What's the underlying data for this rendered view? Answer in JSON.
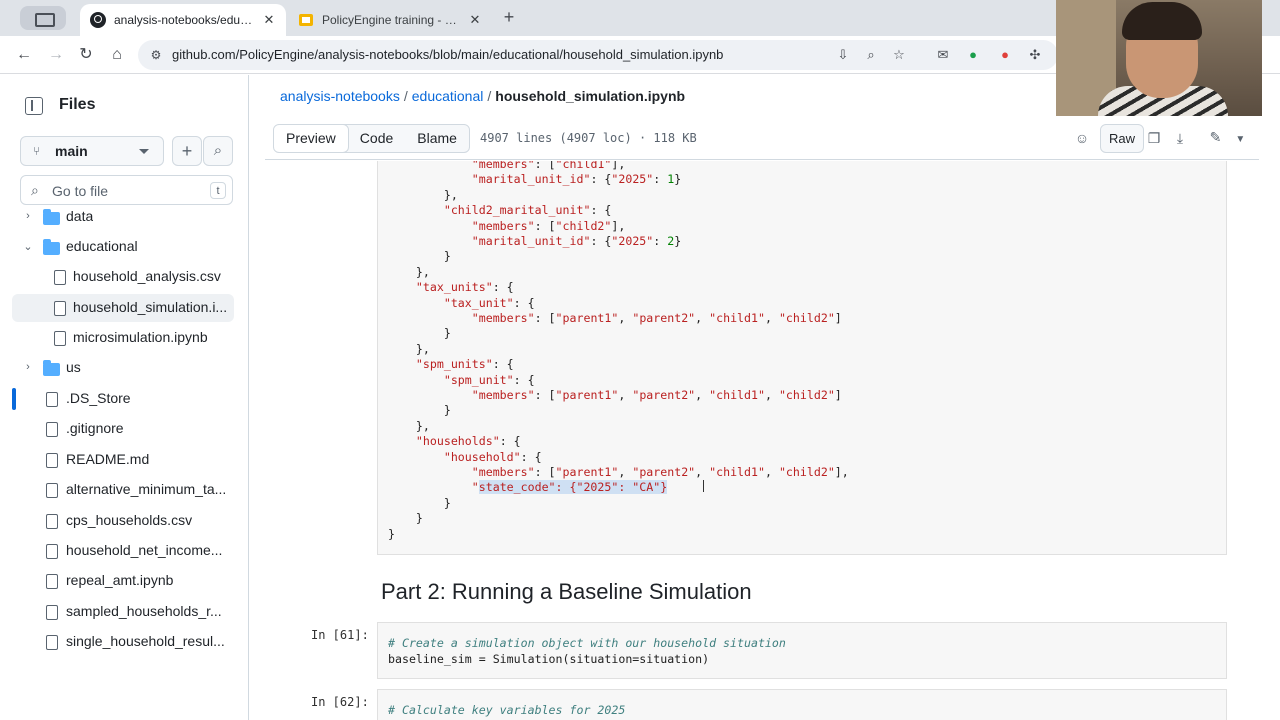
{
  "browser": {
    "tabs": [
      {
        "title": "analysis-notebooks/educatio",
        "active": true
      },
      {
        "title": "PolicyEngine training - 25th J",
        "active": false
      }
    ],
    "url": "github.com/PolicyEngine/analysis-notebooks/blob/main/educational/household_simulation.ipynb"
  },
  "sidebar": {
    "title": "Files",
    "branch": "main",
    "goto_placeholder": "Go to file",
    "goto_shortcut": "t",
    "tree": [
      {
        "label": "data",
        "kind": "folder",
        "expanded": false
      },
      {
        "label": "educational",
        "kind": "folder",
        "expanded": true
      },
      {
        "label": "household_analysis.csv",
        "kind": "file"
      },
      {
        "label": "household_simulation.i...",
        "kind": "file",
        "selected": true
      },
      {
        "label": "microsimulation.ipynb",
        "kind": "file"
      },
      {
        "label": "us",
        "kind": "folder",
        "expanded": false
      },
      {
        "label": ".DS_Store",
        "kind": "file"
      },
      {
        "label": ".gitignore",
        "kind": "file"
      },
      {
        "label": "README.md",
        "kind": "file"
      },
      {
        "label": "alternative_minimum_ta...",
        "kind": "file"
      },
      {
        "label": "cps_households.csv",
        "kind": "file"
      },
      {
        "label": "household_net_income...",
        "kind": "file"
      },
      {
        "label": "repeal_amt.ipynb",
        "kind": "file"
      },
      {
        "label": "sampled_households_r...",
        "kind": "file"
      },
      {
        "label": "single_household_resul...",
        "kind": "file"
      }
    ]
  },
  "breadcrumb": {
    "repo": "analysis-notebooks",
    "folder": "educational",
    "file": "household_simulation.ipynb",
    "sep": "/"
  },
  "filebar": {
    "tabs": [
      "Preview",
      "Code",
      "Blame"
    ],
    "active_tab": "Preview",
    "info": "4907 lines (4907 loc) · 118 KB",
    "raw_label": "Raw"
  },
  "notebook": {
    "code_lines": [
      {
        "indent": "            ",
        "parts": [
          [
            "str",
            "\"members\""
          ],
          [
            "",
            ": ["
          ],
          [
            "str",
            "\"child1\""
          ],
          [
            "",
            "],"
          ]
        ]
      },
      {
        "indent": "            ",
        "parts": [
          [
            "str",
            "\"marital_unit_id\""
          ],
          [
            "",
            ": {"
          ],
          [
            "str",
            "\"2025\""
          ],
          [
            "",
            ": "
          ],
          [
            "num",
            "1"
          ],
          [
            "",
            "}"
          ]
        ]
      },
      {
        "indent": "        ",
        "parts": [
          [
            "",
            "},"
          ]
        ]
      },
      {
        "indent": "        ",
        "parts": [
          [
            "str",
            "\"child2_marital_unit\""
          ],
          [
            "",
            ": {"
          ]
        ]
      },
      {
        "indent": "            ",
        "parts": [
          [
            "str",
            "\"members\""
          ],
          [
            "",
            ": ["
          ],
          [
            "str",
            "\"child2\""
          ],
          [
            "",
            "],"
          ]
        ]
      },
      {
        "indent": "            ",
        "parts": [
          [
            "str",
            "\"marital_unit_id\""
          ],
          [
            "",
            ": {"
          ],
          [
            "str",
            "\"2025\""
          ],
          [
            "",
            ": "
          ],
          [
            "num",
            "2"
          ],
          [
            "",
            "}"
          ]
        ]
      },
      {
        "indent": "        ",
        "parts": [
          [
            "",
            "}"
          ]
        ]
      },
      {
        "indent": "    ",
        "parts": [
          [
            "",
            "},"
          ]
        ]
      },
      {
        "indent": "    ",
        "parts": [
          [
            "str",
            "\"tax_units\""
          ],
          [
            "",
            ": {"
          ]
        ]
      },
      {
        "indent": "        ",
        "parts": [
          [
            "str",
            "\"tax_unit\""
          ],
          [
            "",
            ": {"
          ]
        ]
      },
      {
        "indent": "            ",
        "parts": [
          [
            "str",
            "\"members\""
          ],
          [
            "",
            ": ["
          ],
          [
            "str",
            "\"parent1\""
          ],
          [
            "",
            ", "
          ],
          [
            "str",
            "\"parent2\""
          ],
          [
            "",
            ", "
          ],
          [
            "str",
            "\"child1\""
          ],
          [
            "",
            ", "
          ],
          [
            "str",
            "\"child2\""
          ],
          [
            "",
            "]"
          ]
        ]
      },
      {
        "indent": "        ",
        "parts": [
          [
            "",
            "}"
          ]
        ]
      },
      {
        "indent": "    ",
        "parts": [
          [
            "",
            "},"
          ]
        ]
      },
      {
        "indent": "    ",
        "parts": [
          [
            "str",
            "\"spm_units\""
          ],
          [
            "",
            ": {"
          ]
        ]
      },
      {
        "indent": "        ",
        "parts": [
          [
            "str",
            "\"spm_unit\""
          ],
          [
            "",
            ": {"
          ]
        ]
      },
      {
        "indent": "            ",
        "parts": [
          [
            "str",
            "\"members\""
          ],
          [
            "",
            ": ["
          ],
          [
            "str",
            "\"parent1\""
          ],
          [
            "",
            ", "
          ],
          [
            "str",
            "\"parent2\""
          ],
          [
            "",
            ", "
          ],
          [
            "str",
            "\"child1\""
          ],
          [
            "",
            ", "
          ],
          [
            "str",
            "\"child2\""
          ],
          [
            "",
            "]"
          ]
        ]
      },
      {
        "indent": "        ",
        "parts": [
          [
            "",
            "}"
          ]
        ]
      },
      {
        "indent": "    ",
        "parts": [
          [
            "",
            "},"
          ]
        ]
      },
      {
        "indent": "    ",
        "parts": [
          [
            "str",
            "\"households\""
          ],
          [
            "",
            ": {"
          ]
        ]
      },
      {
        "indent": "        ",
        "parts": [
          [
            "str",
            "\"household\""
          ],
          [
            "",
            ": {"
          ]
        ]
      },
      {
        "indent": "            ",
        "parts": [
          [
            "str",
            "\"members\""
          ],
          [
            "",
            ": ["
          ],
          [
            "str",
            "\"parent1\""
          ],
          [
            "",
            ", "
          ],
          [
            "str",
            "\"parent2\""
          ],
          [
            "",
            ", "
          ],
          [
            "str",
            "\"child1\""
          ],
          [
            "",
            ", "
          ],
          [
            "str",
            "\"child2\""
          ],
          [
            "",
            "],"
          ]
        ]
      },
      {
        "indent": "            ",
        "parts": [
          [
            "str",
            "\""
          ],
          [
            "strhl",
            "state_code\": {\"2025\": \"CA\"}"
          ]
        ]
      },
      {
        "indent": "        ",
        "parts": [
          [
            "",
            "}"
          ]
        ]
      },
      {
        "indent": "    ",
        "parts": [
          [
            "",
            "}"
          ]
        ]
      },
      {
        "indent": "",
        "parts": [
          [
            "",
            "}"
          ]
        ]
      }
    ],
    "heading": "Part 2: Running a Baseline Simulation",
    "cell61": {
      "prompt": "In [61]:",
      "comment": "# Create a simulation object with our household situation",
      "code": "baseline_sim = Simulation(situation=situation)"
    },
    "cell62": {
      "prompt": "In [62]:",
      "comment": "# Calculate key variables for 2025"
    }
  }
}
